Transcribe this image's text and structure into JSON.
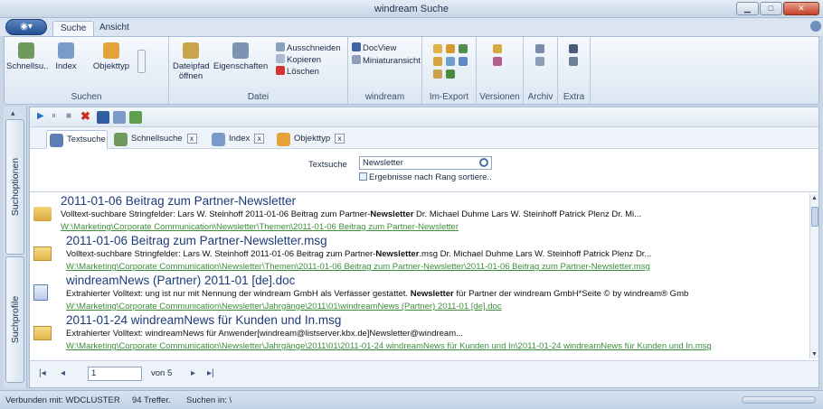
{
  "window": {
    "title": "windream Suche"
  },
  "ribbon_tabs": [
    "Suche",
    "Ansicht"
  ],
  "ribbon": {
    "groups": {
      "suchen": {
        "label": "Suchen",
        "schnellsuche": "Schnellsu..",
        "index": "Index",
        "objekttyp": "Objekttyp"
      },
      "datei": {
        "label": "Datei",
        "dateipfad_line1": "Dateipfad",
        "dateipfad_line2": "öffnen",
        "eigenschaften": "Eigenschaften",
        "ausschneiden": "Ausschneiden",
        "kopieren": "Kopieren",
        "loeschen": "Löschen"
      },
      "windream": {
        "label": "windream",
        "docview": "DocView",
        "miniatur": "Miniaturansicht"
      },
      "im_export": {
        "label": "Im-Export"
      },
      "versionen": {
        "label": "Versionen"
      },
      "archiv": {
        "label": "Archiv"
      },
      "extra": {
        "label": "Extra"
      }
    }
  },
  "side_tabs": [
    "Suchoptionen",
    "Suchprofile"
  ],
  "search_tabs": [
    "Textsuche",
    "Schnellsuche",
    "Index",
    "Objekttyp"
  ],
  "search_panel": {
    "label": "Textsuche",
    "value": "Newsletter",
    "checkbox_label": "Ergebnisse nach Rang sortiere.."
  },
  "results": [
    {
      "title": "2011-01-06 Beitrag zum Partner-Newsletter",
      "snippet_before": "Volltext-suchbare Stringfelder: Lars W. Steinhoff 2011-01-06 Beitrag zum Partner-",
      "snippet_bold": "Newsletter",
      "snippet_after": "  Dr. Michael Duhme Lars W. Steinhoff Patrick Plenz  Dr. Mi...",
      "path": "W:\\Marketing\\Corporate Communication\\Newsletter\\Themen\\2011-01-06 Beitrag zum Partner-Newsletter",
      "icon": "folder-icon"
    },
    {
      "title": "2011-01-06 Beitrag zum Partner-Newsletter.msg",
      "snippet_before": "Volltext-suchbare Stringfelder: Lars W. Steinhoff 2011-01-06 Beitrag zum Partner-",
      "snippet_bold": "Newsletter",
      "snippet_after": ".msg  Dr. Michael Duhme Lars W. Steinhoff Patrick Plenz  Dr...",
      "path": "W:\\Marketing\\Corporate Communication\\Newsletter\\Themen\\2011-01-06 Beitrag zum Partner-Newsletter\\2011-01-06 Beitrag zum Partner-Newsletter.msg",
      "icon": "mail-icon"
    },
    {
      "title": "windreamNews (Partner) 2011-01 [de].doc",
      "snippet_before": "Extrahierter Volltext: ung ist nur mit Nennung der windream GmbH als Verfasser gestattet.        ",
      "snippet_bold": "Newsletter",
      "snippet_after": " für Partner der windream GmbH*Seite   © by windream® Gmb",
      "path": "W:\\Marketing\\Corporate Communication\\Newsletter\\Jahrgänge\\2011\\01\\windreamNews (Partner) 2011-01 [de].doc",
      "icon": "document-icon"
    },
    {
      "title": "2011-01-24 windreamNews für Kunden und In.msg",
      "snippet_before": "Extrahierter Volltext: windreamNews für Anwender[windream@listserver.kbx.de]Newsletter@windream...",
      "snippet_bold": "",
      "snippet_after": "",
      "path": "W:\\Marketing\\Corporate Communication\\Newsletter\\Jahrgänge\\2011\\01\\2011-01-24 windreamNews für Kunden und In\\2011-01-24 windreamNews für Kunden und In.msg",
      "icon": "mail-icon"
    }
  ],
  "pager": {
    "page": "1",
    "of_label": "von 5"
  },
  "status": {
    "connected": "Verbunden mit: WDCLUSTER",
    "hits": "94 Treffer.",
    "search_in": "Suchen in: \\"
  }
}
